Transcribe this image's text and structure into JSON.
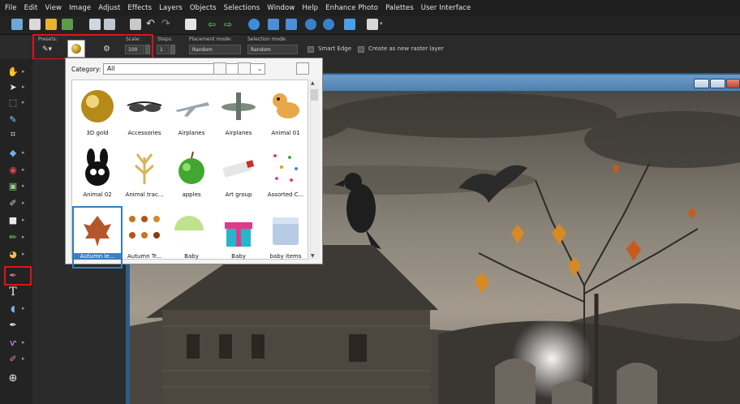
{
  "menu": [
    "File",
    "Edit",
    "View",
    "Image",
    "Adjust",
    "Effects",
    "Layers",
    "Objects",
    "Selections",
    "Window",
    "Help",
    "Enhance Photo",
    "Palettes",
    "User Interface"
  ],
  "tool_options": {
    "presets_label": "Presets:",
    "scale_label": "Scale:",
    "scale_value": "100",
    "steps_label": "Steps:",
    "steps_value": "1",
    "placement_label": "Placement mode:",
    "placement_value": "Random",
    "selection_label": "Selection mode:",
    "selection_value": "Random",
    "smart_edge_label": "Smart Edge",
    "raster_label": "Create as new raster layer"
  },
  "popup": {
    "category_label": "Category:",
    "category_value": "All",
    "items": [
      {
        "label": "3D gold",
        "icon": "gold-sphere-icon"
      },
      {
        "label": "Accessories",
        "icon": "sunglasses-icon"
      },
      {
        "label": "Airplanes",
        "icon": "jet-plane-icon"
      },
      {
        "label": "Airplanes",
        "icon": "propeller-plane-icon"
      },
      {
        "label": "Animal 01",
        "icon": "cartoon-dog-icon"
      },
      {
        "label": "Animal 02",
        "icon": "cartoon-bunny-icon"
      },
      {
        "label": "Animal trac...",
        "icon": "bird-tracks-icon"
      },
      {
        "label": "apples",
        "icon": "green-apple-icon"
      },
      {
        "label": "Art group",
        "icon": "paint-tube-icon"
      },
      {
        "label": "Assorted C...",
        "icon": "confetti-icon"
      },
      {
        "label": "Autumn le...",
        "icon": "autumn-leaf-icon",
        "selected": true
      },
      {
        "label": "Autumn Tr...",
        "icon": "autumn-trees-icon"
      },
      {
        "label": "Baby",
        "icon": "baby-rattle-icon"
      },
      {
        "label": "Baby",
        "icon": "gift-box-icon"
      },
      {
        "label": "baby items",
        "icon": "abc-blocks-icon"
      }
    ]
  },
  "colors": {
    "highlight_red": "#e1121c",
    "accent_blue": "#2f7fc1",
    "menu_bg": "#1f1f1f"
  }
}
